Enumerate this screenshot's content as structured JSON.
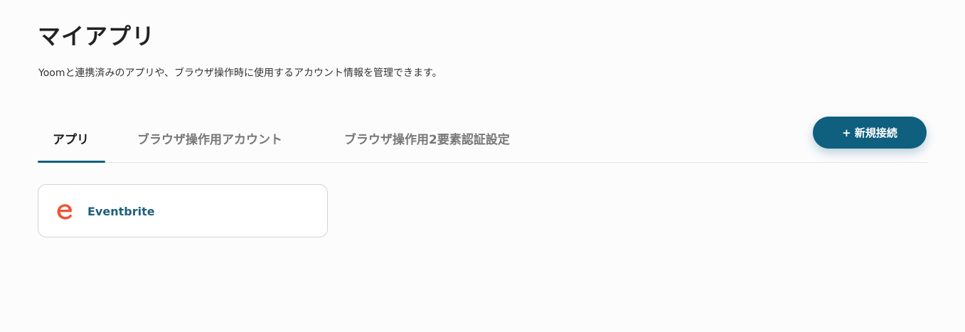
{
  "header": {
    "title": "マイアプリ",
    "description": "Yoomと連携済みのアプリや、ブラウザ操作時に使用するアカウント情報を管理できます。"
  },
  "tabs": [
    {
      "label": "アプリ",
      "active": true
    },
    {
      "label": "ブラウザ操作用アカウント",
      "active": false
    },
    {
      "label": "ブラウザ操作用2要素認証設定",
      "active": false
    }
  ],
  "actions": {
    "new_connection_label": "+ 新規接続"
  },
  "apps": [
    {
      "name": "Eventbrite",
      "icon": "eventbrite-logo-icon",
      "brand_color": "#f05537"
    }
  ],
  "colors": {
    "accent": "#135f7e",
    "app_name": "#1f5f7e",
    "background": "#fdfcfd"
  }
}
